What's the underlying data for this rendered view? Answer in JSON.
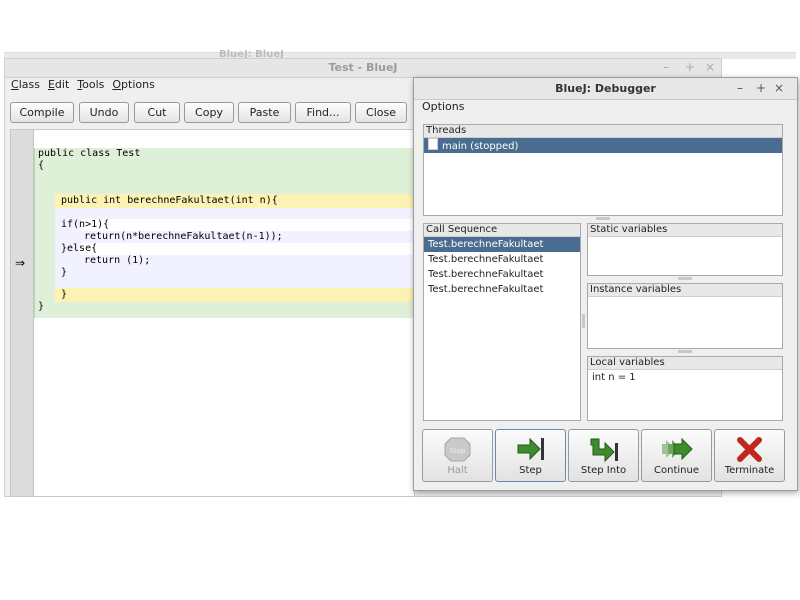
{
  "background_window": {
    "title": "BlueJ: BlueJ"
  },
  "editor": {
    "title": "Test - BlueJ",
    "menu": [
      "Class",
      "Edit",
      "Tools",
      "Options"
    ],
    "toolbar": [
      "Compile",
      "Undo",
      "Cut",
      "Copy",
      "Paste",
      "Find...",
      "Close"
    ],
    "code": {
      "line1": "public class Test",
      "line2": "{",
      "line3": "public int berechneFakultaet(int n){",
      "line4": "if(n>1){",
      "line5": "return(n*berechneFakultaet(n-1));",
      "line6": "}else{",
      "line7": "return (1);",
      "line8": "}",
      "line9": "}",
      "line10": "}"
    },
    "current_line_marker": "⇒",
    "window_controls": [
      "–",
      "+",
      "×"
    ]
  },
  "debugger": {
    "title": "BlueJ:  Debugger",
    "window_controls": [
      "–",
      "+",
      "×"
    ],
    "menu": "Options",
    "threads": {
      "header": "Threads",
      "items": [
        "main (stopped)"
      ]
    },
    "call_sequence": {
      "header": "Call Sequence",
      "items": [
        "Test.berechneFakultaet",
        "Test.berechneFakultaet",
        "Test.berechneFakultaet",
        "Test.berechneFakultaet"
      ]
    },
    "static_variables": {
      "header": "Static variables"
    },
    "instance_variables": {
      "header": "Instance variables"
    },
    "local_variables": {
      "header": "Local variables",
      "items": [
        "int n = 1"
      ]
    },
    "buttons": {
      "halt": "Halt",
      "halt_icon_text": "Stop",
      "step": "Step",
      "step_into": "Step Into",
      "continue": "Continue",
      "terminate": "Terminate"
    }
  }
}
